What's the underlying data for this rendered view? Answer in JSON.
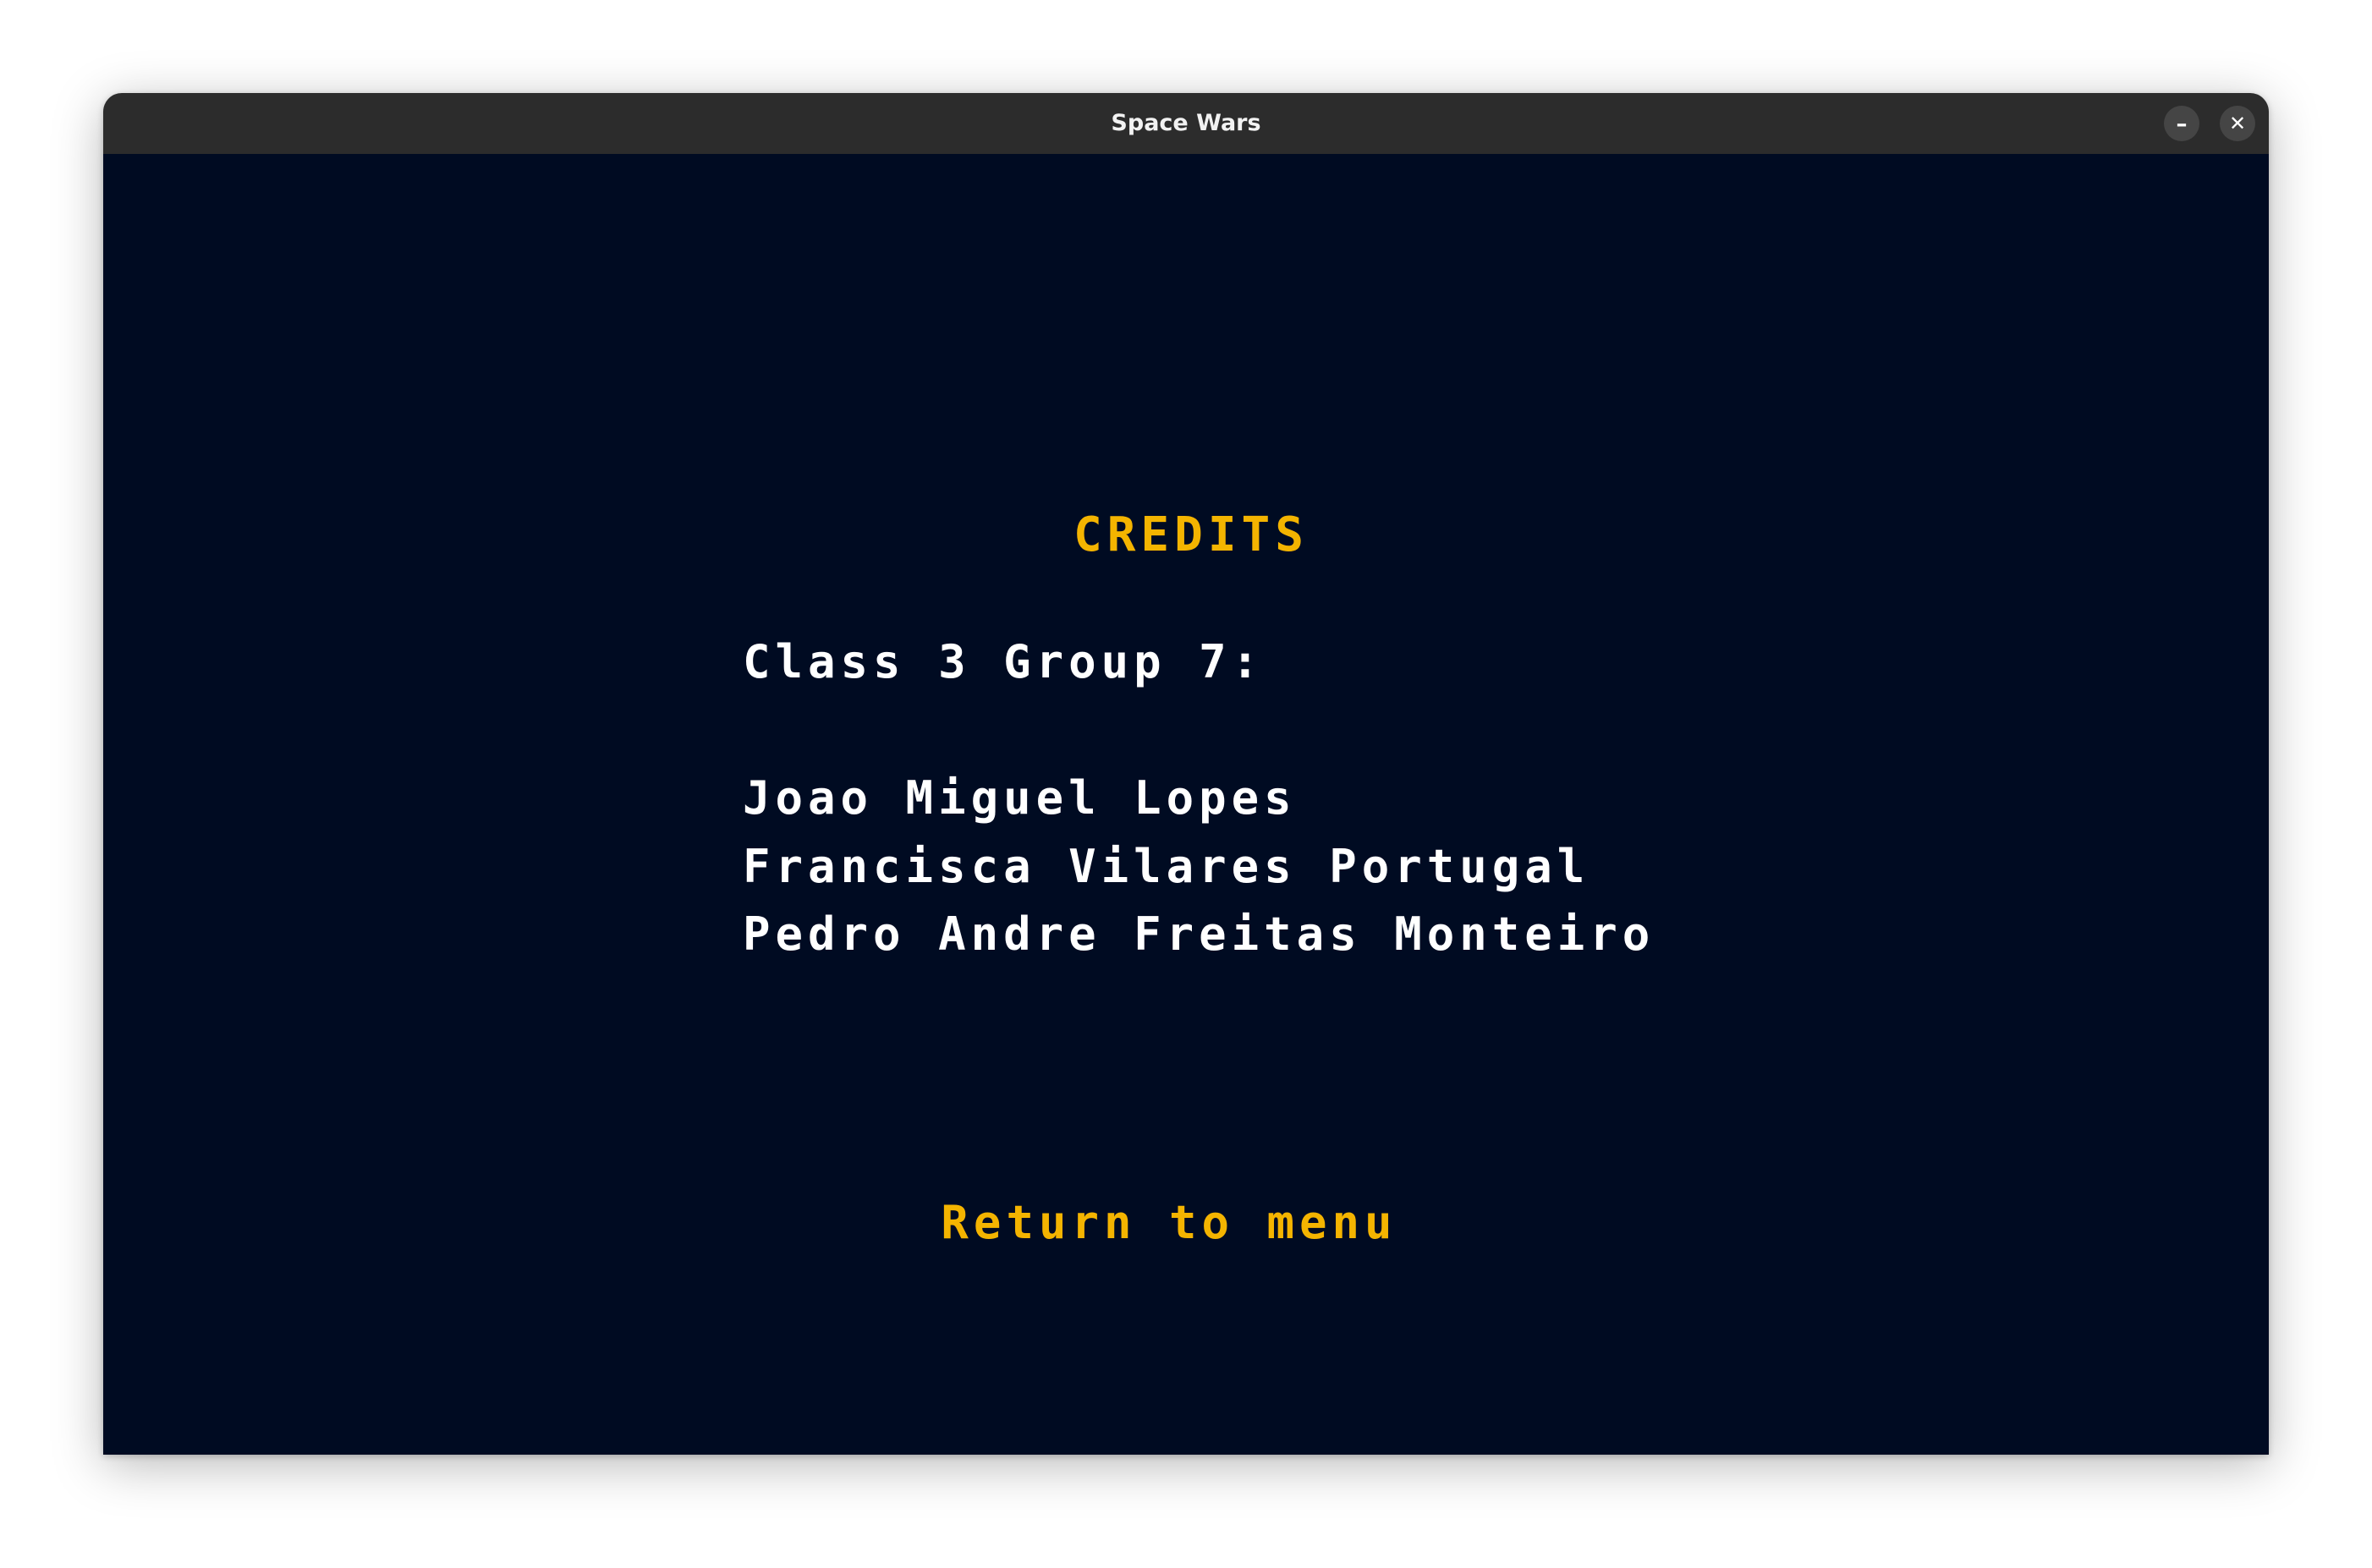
{
  "window": {
    "title": "Space Wars",
    "minimize_symbol": "–",
    "close_symbol": "✕"
  },
  "screen": {
    "heading": "CREDITS",
    "group_line": "Class 3 Group 7:",
    "members": [
      "Joao Miguel Lopes",
      "Francisca Vilares Portugal",
      "Pedro Andre Freitas Monteiro"
    ],
    "return_label": "Return to menu"
  },
  "colors": {
    "background": "#000b22",
    "accent": "#f4b400",
    "text": "#ffffff",
    "titlebar": "#2c2c2c"
  }
}
